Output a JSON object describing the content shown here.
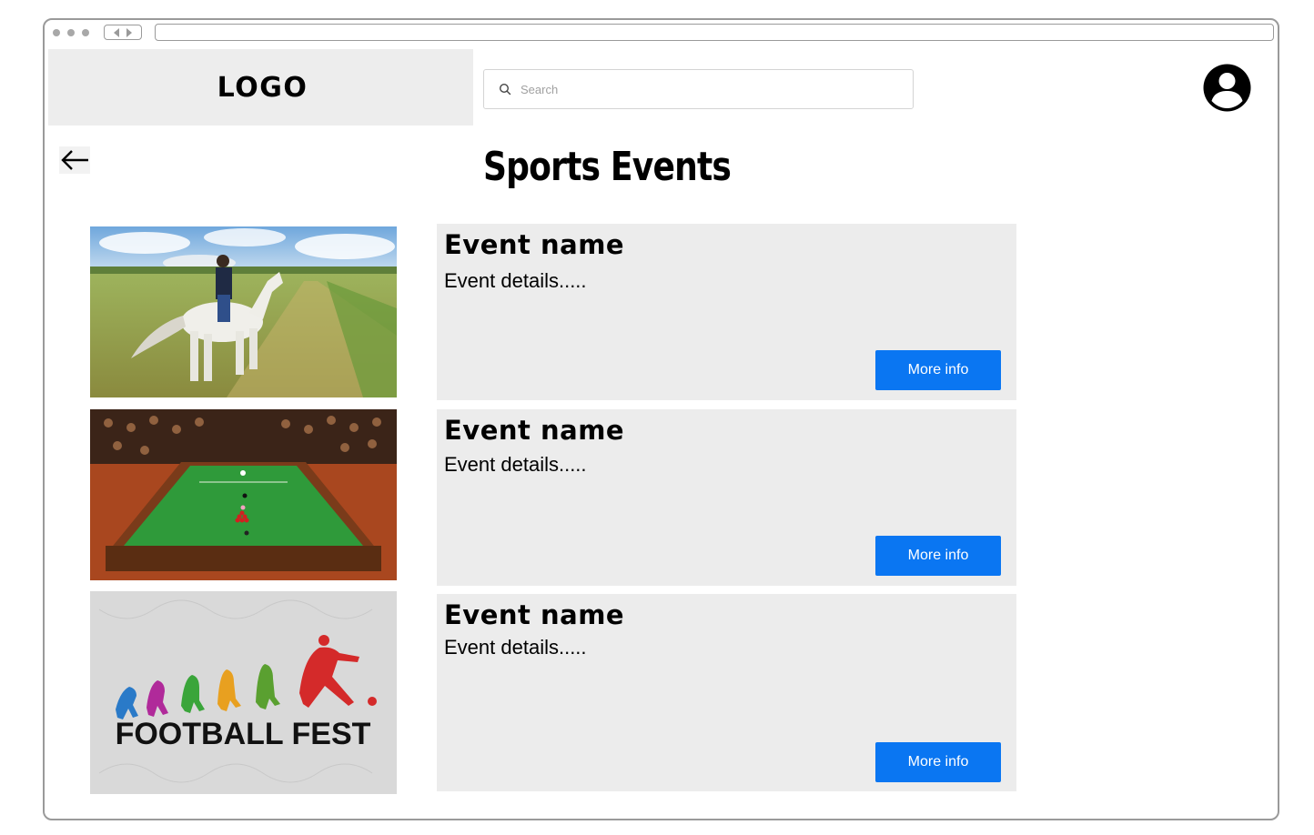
{
  "header": {
    "logo": "LOGO",
    "search": {
      "placeholder": "Search",
      "value": ""
    }
  },
  "page": {
    "title": "Sports Events"
  },
  "events": [
    {
      "name": "Event name",
      "details": "Event details.....",
      "button": "More info",
      "image": "horse-riding"
    },
    {
      "name": "Event name",
      "details": "Event details.....",
      "button": "More info",
      "image": "snooker"
    },
    {
      "name": "Event name",
      "details": "Event details.....",
      "button": "More info",
      "image": "football-fest",
      "image_text": "FOOTBALL FEST"
    }
  ],
  "colors": {
    "accent": "#0a76f2",
    "card_bg": "#ececec",
    "logo_bg": "#ededed",
    "border": "#9a9a9a"
  },
  "icons": [
    "search-icon",
    "user-avatar-icon",
    "back-arrow-icon",
    "browser-back-icon",
    "browser-forward-icon"
  ]
}
